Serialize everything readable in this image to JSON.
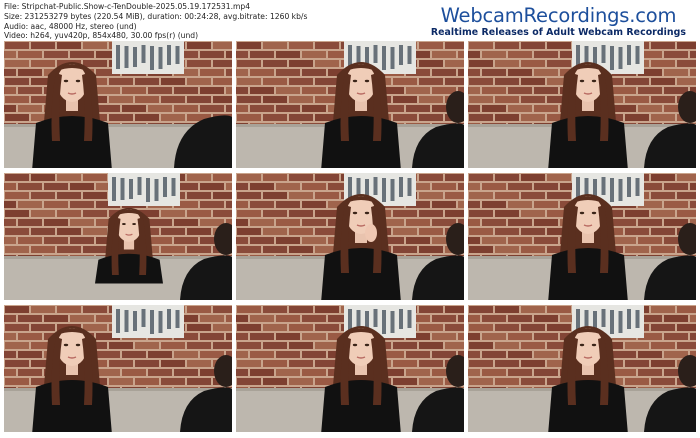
{
  "info": {
    "file": "File: Stripchat-Public.Show-c-TenDouble-2025.05.19.172531.mp4",
    "size": "Size: 231253279 bytes (220.54 MiB), duration: 00:24:28, avg.bitrate: 1260 kb/s",
    "audio": "Audio: aac, 48000 Hz, stereo (und)",
    "video": "Video: h264, yuv420p, 854x480, 30.00 fps(r) (und)"
  },
  "brand": {
    "title": "WebcamRecordings.com",
    "subtitle": "Realtime Releases of Adult Webcam Recordings"
  },
  "thumbnails": [
    {
      "pose": "left"
    },
    {
      "pose": "center"
    },
    {
      "pose": "right"
    },
    {
      "pose": "left-small"
    },
    {
      "pose": "center-hand"
    },
    {
      "pose": "right"
    },
    {
      "pose": "left"
    },
    {
      "pose": "center"
    },
    {
      "pose": "right"
    }
  ],
  "colors": {
    "brick": "#8a4b3a",
    "mortar": "#c9a48c",
    "sofa": "#bdb7ae",
    "hair": "#5a2f1f",
    "shirt": "#111111",
    "brand_blue": "#1d4f9c"
  }
}
